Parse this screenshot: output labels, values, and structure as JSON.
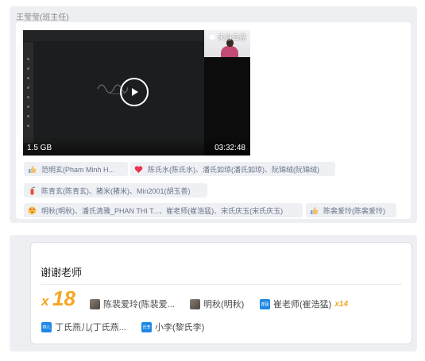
{
  "message": {
    "sender": "王莹莹(班主任)",
    "video": {
      "size": "1.5 GB",
      "duration": "03:32:48",
      "cloud_tag": "来自云盘"
    },
    "reactions": [
      {
        "emoji": "thumbs-up-icon",
        "names": "范明玄(Pham Minh H..."
      },
      {
        "emoji": "heart-icon",
        "names": "陈氏水(陈氏水)、潘氏如琼(潘氏如琼)、阮锦绒(阮锦绒)"
      },
      {
        "emoji": "fire-extinguisher-icon",
        "names": "陈青玄(陈青玄)、猪米(猪米)、Min2001(胡玉善)"
      },
      {
        "emoji": "heart-eyes-icon",
        "names": "明秋(明秋)、潘氏清雅_PHAN THI T...、崔老师(崔浩猛)、宋氏庆玉(宋氏庆玉)"
      },
      {
        "emoji": "thumbs-up-icon",
        "names": "陈裴爱玲(陈裴爱玲)"
      }
    ]
  },
  "card": {
    "title": "谢谢老师",
    "plus_prefix": "x",
    "plus_count": "18",
    "participants": [
      {
        "name": "陈裴爱玲(陈裴爱...",
        "avatar": "photo"
      },
      {
        "name": "明秋(明秋)",
        "avatar": "photo"
      },
      {
        "name": "崔老师(崔浩猛)",
        "avatar": "blue",
        "avatar_text": "崔猛",
        "multiplier": "x14"
      },
      {
        "name": "丁氏燕儿(丁氏燕...",
        "avatar": "blue",
        "avatar_text": "燕儿"
      },
      {
        "name": "小李(黎氏李)",
        "avatar": "blue",
        "avatar_text": "氏李"
      }
    ]
  },
  "colors": {
    "accent_orange": "#f5a623",
    "chip_bg": "#eef0f4",
    "panel_bg": "#eeeff2",
    "avatar_blue": "#1e88e5"
  }
}
